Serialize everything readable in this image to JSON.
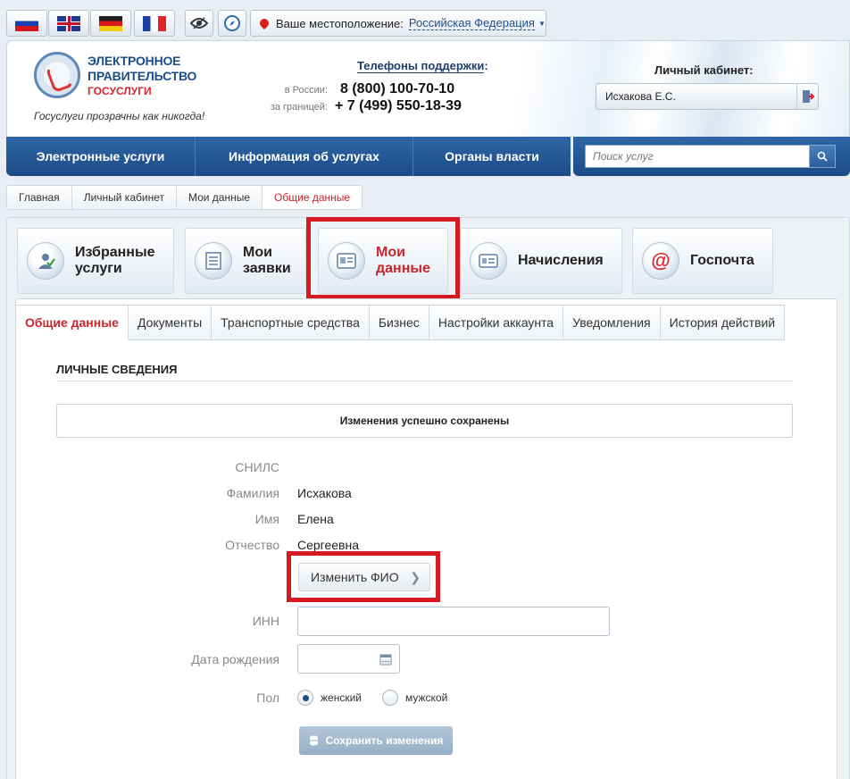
{
  "topbar": {
    "languages": [
      {
        "name": "ru",
        "icon": "flag-russia-icon"
      },
      {
        "name": "en",
        "icon": "flag-uk-icon"
      },
      {
        "name": "de",
        "icon": "flag-germany-icon"
      },
      {
        "name": "fr",
        "icon": "flag-france-icon"
      }
    ],
    "tools": [
      {
        "icon": "low-vision-eye-icon"
      },
      {
        "icon": "compass-icon"
      }
    ],
    "location_label": "Ваше местоположение:",
    "location_value": "Российская Федерация"
  },
  "header": {
    "logo_line1": "ЭЛЕКТРОННОЕ",
    "logo_line2": "ПРАВИТЕЛЬСТВО",
    "logo_line3": "ГОСУСЛУГИ",
    "slogan": "Госуслуги прозрачны как никогда!",
    "support_title": "Телефоны поддержки",
    "support_colon": ":",
    "phones": [
      {
        "label": "в России:",
        "number": "8 (800) 100-70-10"
      },
      {
        "label": "за границей:",
        "number": "+ 7 (499) 550-18-39"
      }
    ],
    "cabinet_title": "Личный кабинет:",
    "cabinet_user": "Исхакова Е.С."
  },
  "nav": {
    "items": [
      "Электронные услуги",
      "Информация об услугах",
      "Органы власти"
    ],
    "search_placeholder": "Поиск услуг"
  },
  "breadcrumb": [
    "Главная",
    "Личный кабинет",
    "Мои данные",
    "Общие данные"
  ],
  "bigtabs": [
    {
      "line1": "Избранные",
      "line2": "услуги",
      "icon": "favorites-person-icon",
      "active": false
    },
    {
      "line1": "Мои",
      "line2": "заявки",
      "icon": "applications-list-icon",
      "active": false
    },
    {
      "line1": "Мои",
      "line2": "данные",
      "icon": "my-data-card-icon",
      "active": true
    },
    {
      "line1": "Начисления",
      "line2": "",
      "icon": "charges-icon",
      "active": false
    },
    {
      "line1": "Госпочта",
      "line2": "",
      "icon": "mail-at-icon",
      "active": false
    }
  ],
  "tabs": [
    "Общие данные",
    "Документы",
    "Транспортные средства",
    "Бизнес",
    "Настройки аккаунта",
    "Уведомления",
    "История действий"
  ],
  "section": {
    "title": "ЛИЧНЫЕ СВЕДЕНИЯ",
    "notice": "Изменения успешно сохранены"
  },
  "fields": {
    "snils_label": "СНИЛС",
    "surname_label": "Фамилия",
    "surname_value": "Исхакова",
    "name_label": "Имя",
    "name_value": "Елена",
    "patronymic_label": "Отчество",
    "patronymic_value": "Сергеевна",
    "change_fio": "Изменить ФИО",
    "inn_label": "ИНН",
    "birthdate_label": "Дата рождения",
    "gender_label": "Пол",
    "gender_female": "женский",
    "gender_male": "мужской",
    "save": "Сохранить изменения"
  },
  "colors": {
    "brand_blue": "#1c4e87",
    "accent_red": "#c8262c",
    "highlight_red": "#d71920"
  }
}
